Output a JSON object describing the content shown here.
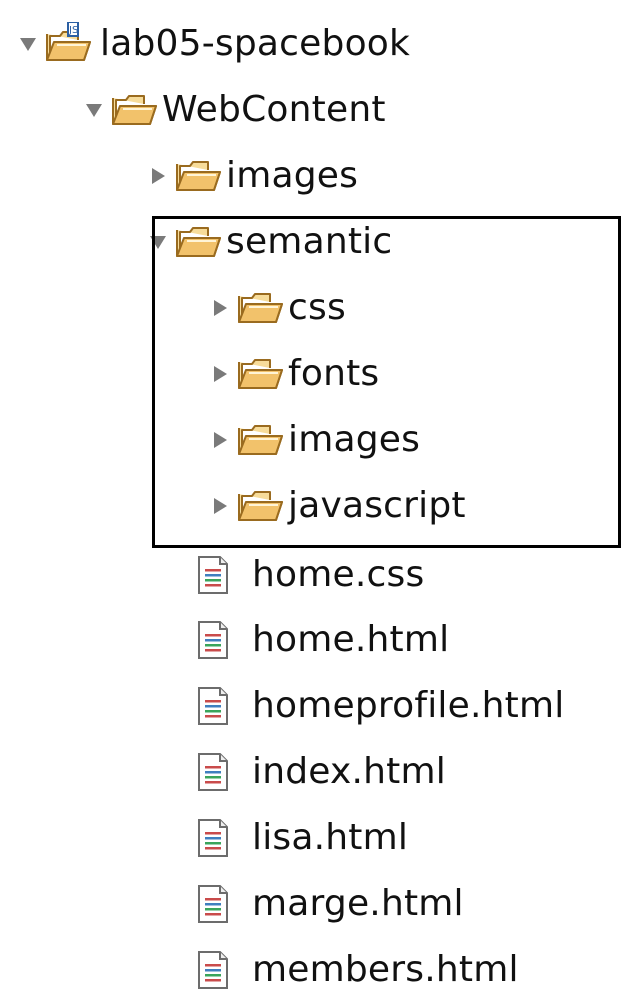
{
  "project": {
    "name": "lab05-spacebook",
    "icon": "project-folder-icon"
  },
  "items": [
    {
      "label": "WebContent",
      "type": "folder",
      "expanded": true
    },
    {
      "label": "images",
      "type": "folder",
      "expanded": false
    },
    {
      "label": "semantic",
      "type": "folder",
      "expanded": true
    },
    {
      "label": "css",
      "type": "folder",
      "expanded": false
    },
    {
      "label": "fonts",
      "type": "folder",
      "expanded": false
    },
    {
      "label": "images",
      "type": "folder",
      "expanded": false
    },
    {
      "label": "javascript",
      "type": "folder",
      "expanded": false
    },
    {
      "label": "home.css",
      "type": "file"
    },
    {
      "label": "home.html",
      "type": "file"
    },
    {
      "label": "homeprofile.html",
      "type": "file"
    },
    {
      "label": "index.html",
      "type": "file"
    },
    {
      "label": "lisa.html",
      "type": "file"
    },
    {
      "label": "marge.html",
      "type": "file"
    },
    {
      "label": "members.html",
      "type": "file"
    }
  ],
  "colors": {
    "twisty": "#7a7a7a",
    "folder": "#e8b55a",
    "highlight": "#000000"
  }
}
